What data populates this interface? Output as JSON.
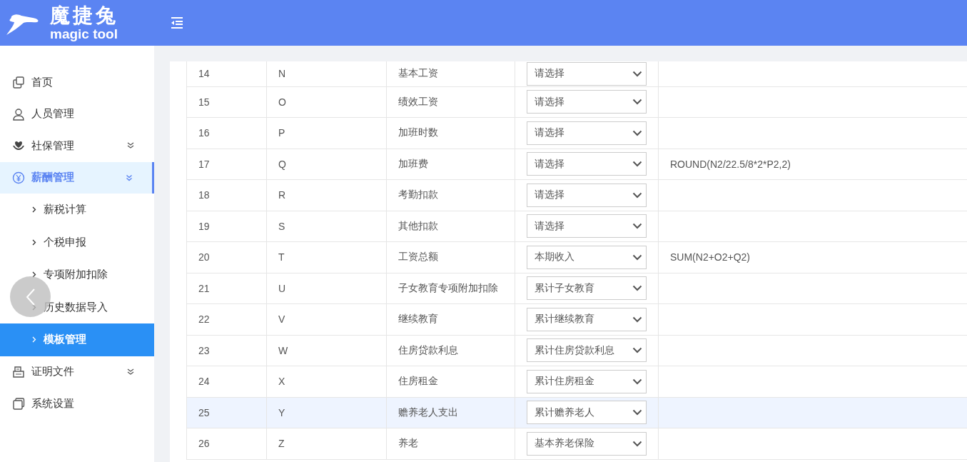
{
  "header": {
    "brand_name": "魔捷兔",
    "brand_subtitle": "magic tool"
  },
  "sidebar": {
    "items": [
      {
        "label": "首页",
        "active": false
      },
      {
        "label": "人员管理",
        "active": false
      },
      {
        "label": "社保管理",
        "active": false,
        "expanded": false
      },
      {
        "label": "薪酬管理",
        "active": true,
        "expanded": true,
        "children": [
          {
            "label": "薪税计算",
            "selected": false
          },
          {
            "label": "个税申报",
            "selected": false
          },
          {
            "label": "专项附加扣除",
            "selected": false
          },
          {
            "label": "历史数据导入",
            "selected": false
          },
          {
            "label": "模板管理",
            "selected": true
          }
        ]
      },
      {
        "label": "证明文件",
        "active": false,
        "expanded": false
      },
      {
        "label": "系统设置",
        "active": false
      }
    ]
  },
  "table": {
    "rows": [
      {
        "index": "14",
        "column": "N",
        "name": "基本工资",
        "mapping": "请选择",
        "selected": false
      },
      {
        "index": "15",
        "column": "O",
        "name": "绩效工资",
        "mapping": "请选择",
        "selected": false
      },
      {
        "index": "16",
        "column": "P",
        "name": "加班时数",
        "mapping": "请选择",
        "selected": false
      },
      {
        "index": "17",
        "column": "Q",
        "name": "加班费",
        "mapping": "请选择",
        "formula": "ROUND(N2/22.5/8*2*P2,2)",
        "selected": false
      },
      {
        "index": "18",
        "column": "R",
        "name": "考勤扣款",
        "mapping": "请选择",
        "selected": false
      },
      {
        "index": "19",
        "column": "S",
        "name": "其他扣款",
        "mapping": "请选择",
        "selected": false
      },
      {
        "index": "20",
        "column": "T",
        "name": "工资总额",
        "mapping": "本期收入",
        "formula": "SUM(N2+O2+Q2)",
        "selected": false
      },
      {
        "index": "21",
        "column": "U",
        "name": "子女教育专项附加扣除",
        "mapping": "累计子女教育",
        "selected": false
      },
      {
        "index": "22",
        "column": "V",
        "name": "继续教育",
        "mapping": "累计继续教育",
        "selected": false
      },
      {
        "index": "23",
        "column": "W",
        "name": "住房贷款利息",
        "mapping": "累计住房贷款利息",
        "selected": false
      },
      {
        "index": "24",
        "column": "X",
        "name": "住房租金",
        "mapping": "累计住房租金",
        "selected": false
      },
      {
        "index": "25",
        "column": "Y",
        "name": "赡养老人支出",
        "mapping": "累计赡养老人",
        "selected": true
      },
      {
        "index": "26",
        "column": "Z",
        "name": "养老",
        "mapping": "基本养老保险",
        "selected": false
      }
    ]
  }
}
